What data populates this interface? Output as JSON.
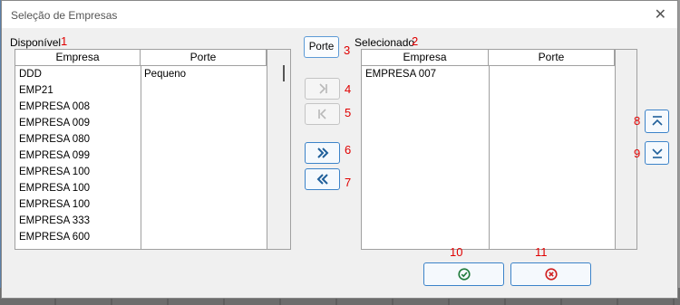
{
  "window": {
    "title": "Seleção de Empresas",
    "close_glyph": "✕"
  },
  "available": {
    "label": "Disponível",
    "marker": "1",
    "columns": [
      "Empresa",
      "Porte"
    ],
    "rows": [
      {
        "empresa": "DDD",
        "porte": "Pequeno"
      },
      {
        "empresa": "EMP21",
        "porte": ""
      },
      {
        "empresa": "EMPRESA 008",
        "porte": ""
      },
      {
        "empresa": "EMPRESA 009",
        "porte": ""
      },
      {
        "empresa": "EMPRESA 080",
        "porte": ""
      },
      {
        "empresa": "EMPRESA 099",
        "porte": ""
      },
      {
        "empresa": "EMPRESA 100",
        "porte": ""
      },
      {
        "empresa": "EMPRESA 100",
        "porte": ""
      },
      {
        "empresa": "EMPRESA 100",
        "porte": ""
      },
      {
        "empresa": "EMPRESA 333",
        "porte": ""
      },
      {
        "empresa": "EMPRESA 600",
        "porte": ""
      }
    ]
  },
  "selected": {
    "label": "Selecionado",
    "marker": "2",
    "columns": [
      "Empresa",
      "Porte"
    ],
    "rows": [
      {
        "empresa": "EMPRESA 007",
        "porte": ""
      }
    ]
  },
  "buttons": {
    "porte": {
      "label": "Porte",
      "marker": "3"
    },
    "move_one_right": {
      "marker": "4"
    },
    "move_one_left": {
      "marker": "5"
    },
    "move_all_right": {
      "marker": "6"
    },
    "move_all_left": {
      "marker": "7"
    },
    "move_top": {
      "marker": "8"
    },
    "move_bottom": {
      "marker": "9"
    },
    "confirm": {
      "marker": "10"
    },
    "cancel": {
      "marker": "11"
    }
  },
  "colors": {
    "accent": "#3c83c9",
    "ok": "#1f7a3a",
    "cancel": "#d01f1f",
    "marker": "#e00000"
  }
}
